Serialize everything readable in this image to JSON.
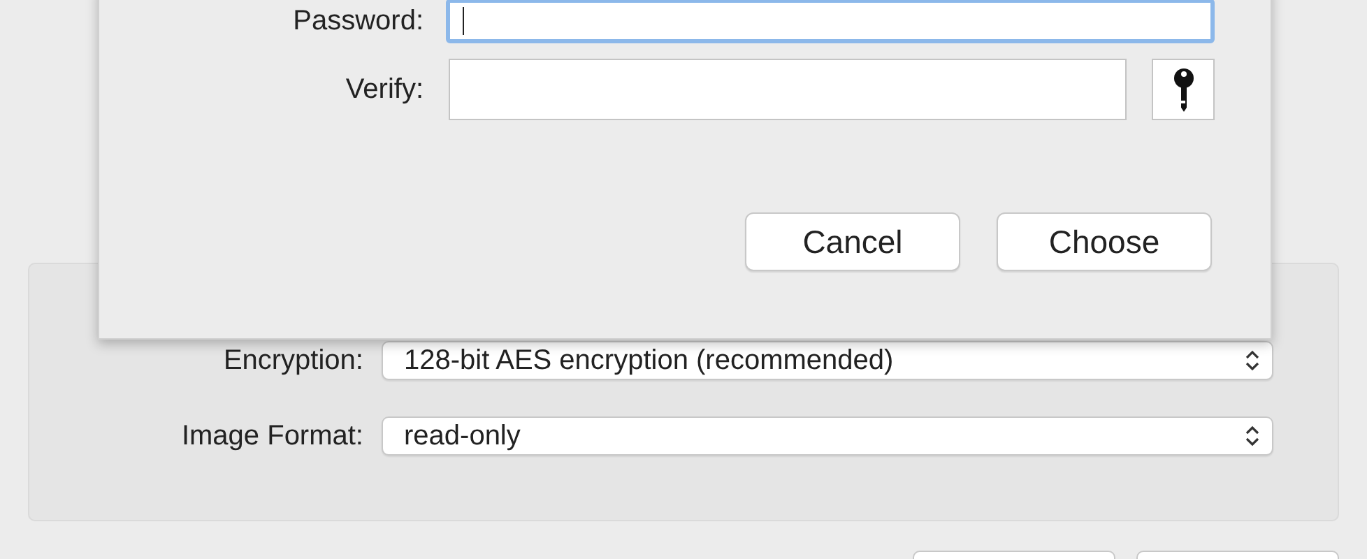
{
  "sheet": {
    "fields": [
      {
        "label": "Password:",
        "focused": true
      },
      {
        "label": "Verify:",
        "focused": false
      }
    ],
    "buttons": [
      "Cancel",
      "Choose"
    ]
  },
  "settings": [
    {
      "label": "Encryption:",
      "value": "128-bit AES encryption (recommended)"
    },
    {
      "label": "Image Format:",
      "value": "read-only"
    }
  ]
}
